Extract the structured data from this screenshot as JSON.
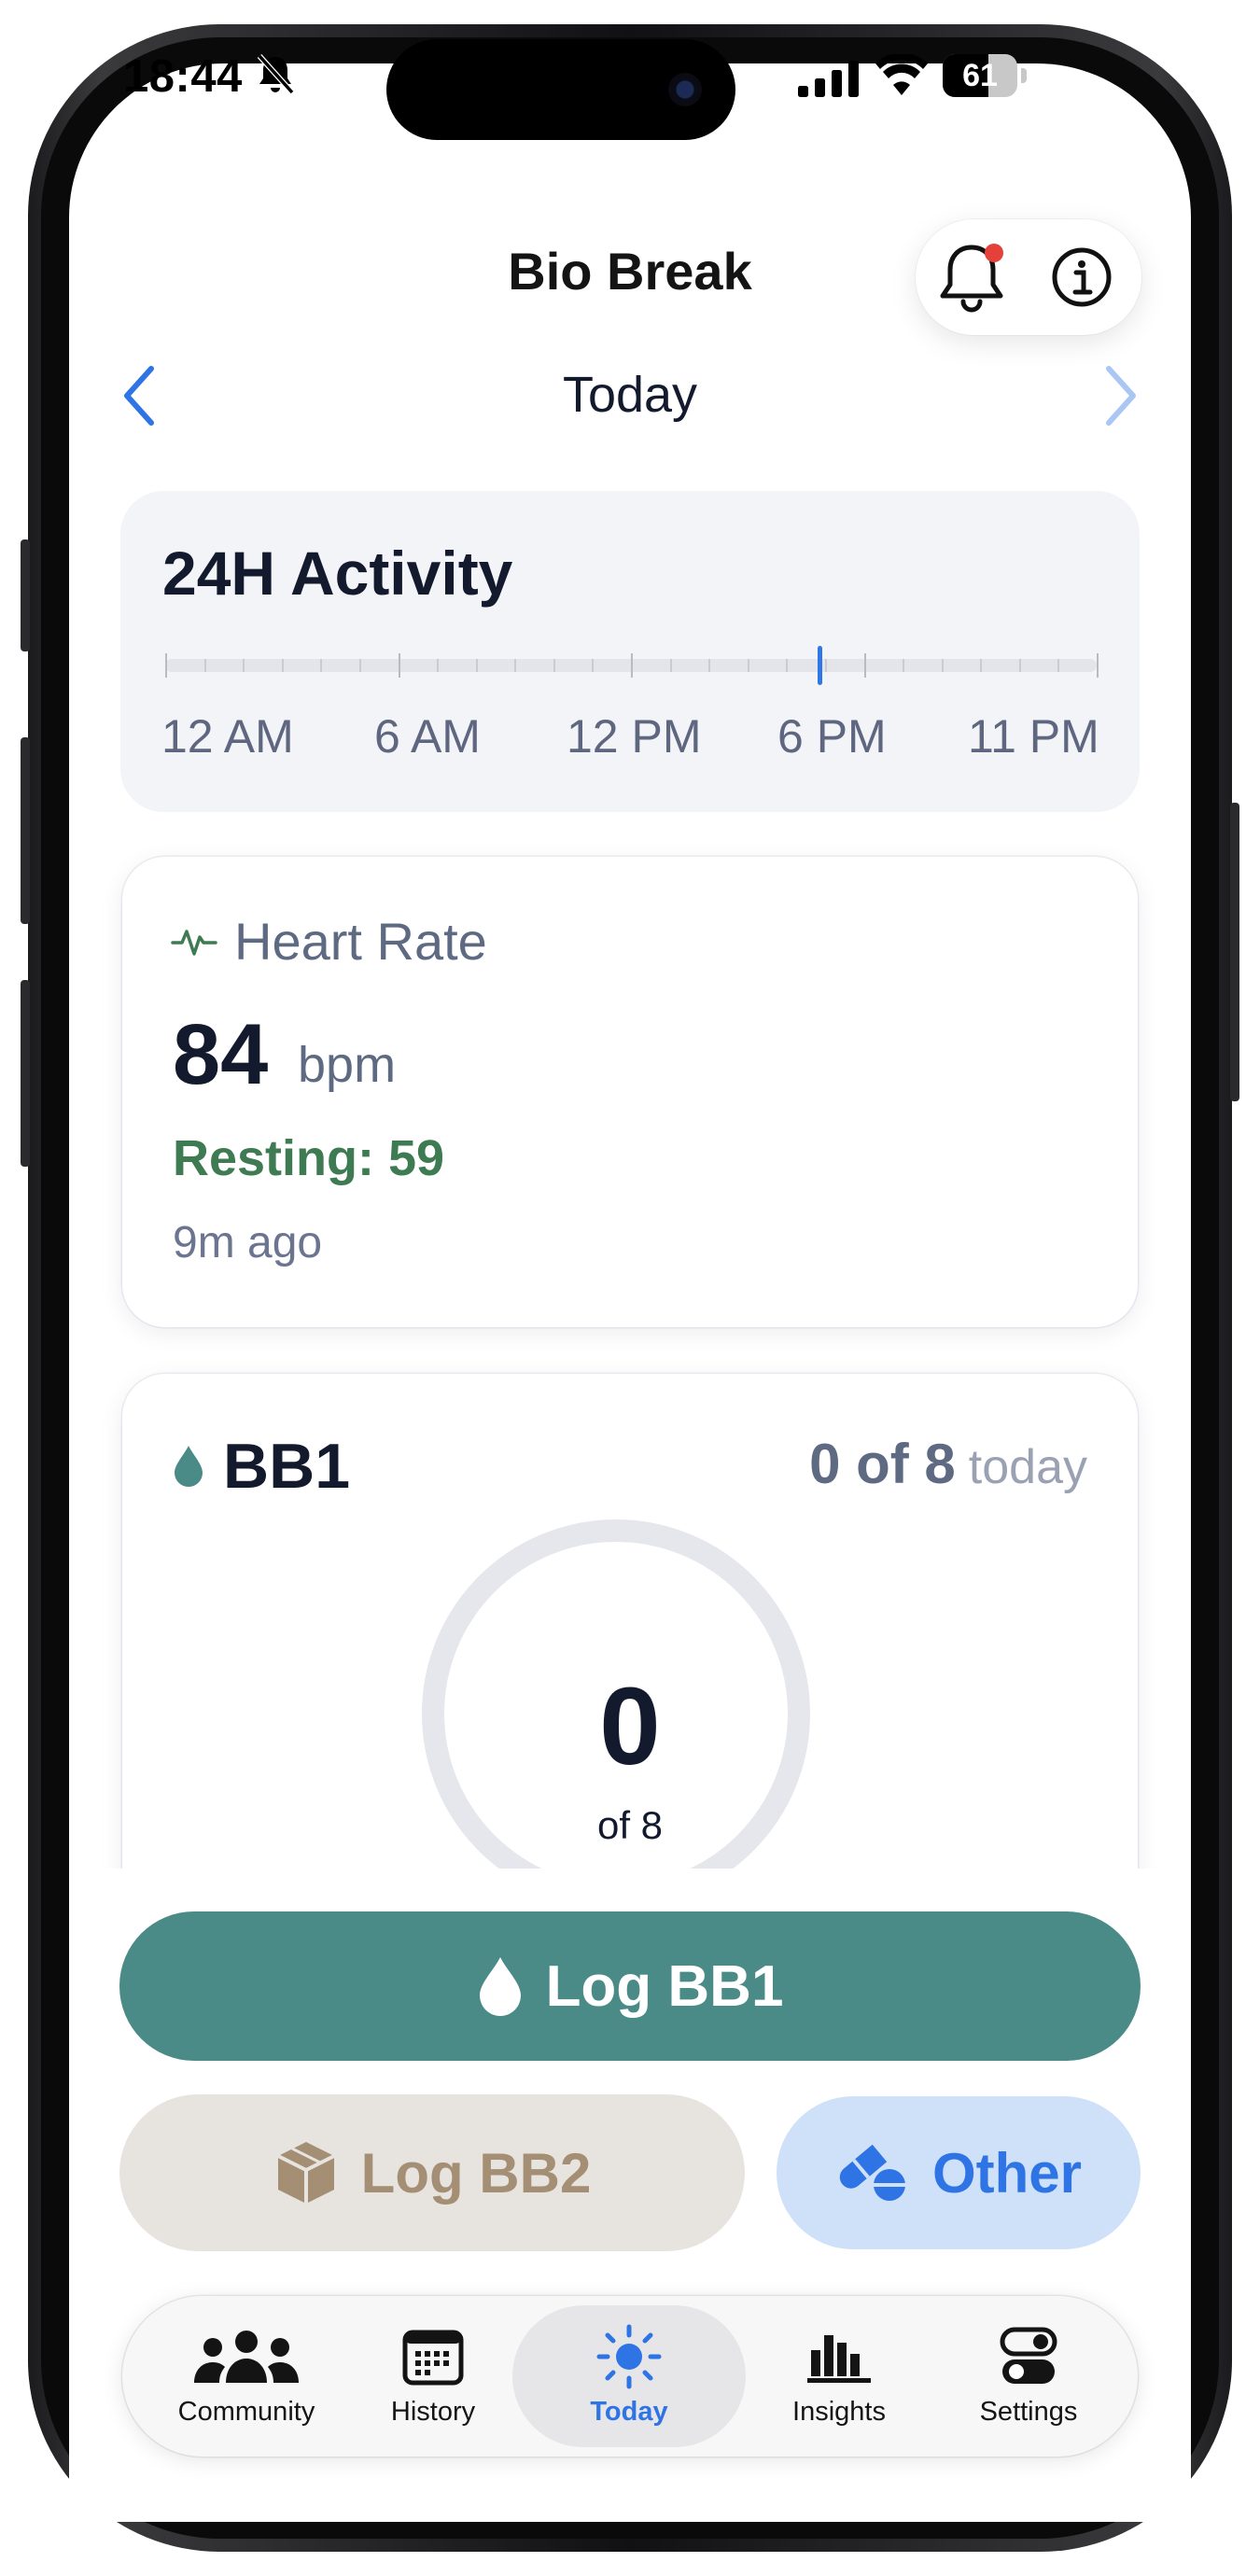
{
  "status_bar": {
    "time": "18:44",
    "battery_level": "61",
    "icons": [
      "bell-slash-icon",
      "signal-icon",
      "wifi-icon",
      "battery-icon"
    ]
  },
  "header": {
    "title": "Bio Break",
    "date_label": "Today",
    "icons": [
      "bell-icon",
      "info-icon",
      "chevron-left-icon",
      "chevron-right-icon"
    ]
  },
  "activity": {
    "title": "24H Activity",
    "time_labels": [
      "12 AM",
      "6 AM",
      "12 PM",
      "6 PM",
      "11 PM"
    ],
    "current_time_fraction": 0.7
  },
  "heart_rate": {
    "title": "Heart Rate",
    "value": "84",
    "unit": "bpm",
    "resting": "Resting: 59",
    "updated": "9m ago"
  },
  "bb1": {
    "title": "BB1",
    "count": "0 of 8",
    "count_suffix": "today",
    "ring_value": "0",
    "ring_of": "of 8",
    "progress": 0
  },
  "actions": {
    "log_bb1": "Log BB1",
    "log_bb2": "Log BB2",
    "other": "Other"
  },
  "tabs": [
    {
      "label": "Community",
      "icon": "people-icon"
    },
    {
      "label": "History",
      "icon": "calendar-icon"
    },
    {
      "label": "Today",
      "icon": "sun-icon",
      "active": true
    },
    {
      "label": "Insights",
      "icon": "bar-chart-icon"
    },
    {
      "label": "Settings",
      "icon": "toggles-icon"
    }
  ],
  "colors": {
    "accent_blue": "#2f74e4",
    "teal": "#4a8a87",
    "resting_green": "#3e7a52",
    "bb2_tan": "#a48e74",
    "notification_red": "#e5403a"
  }
}
